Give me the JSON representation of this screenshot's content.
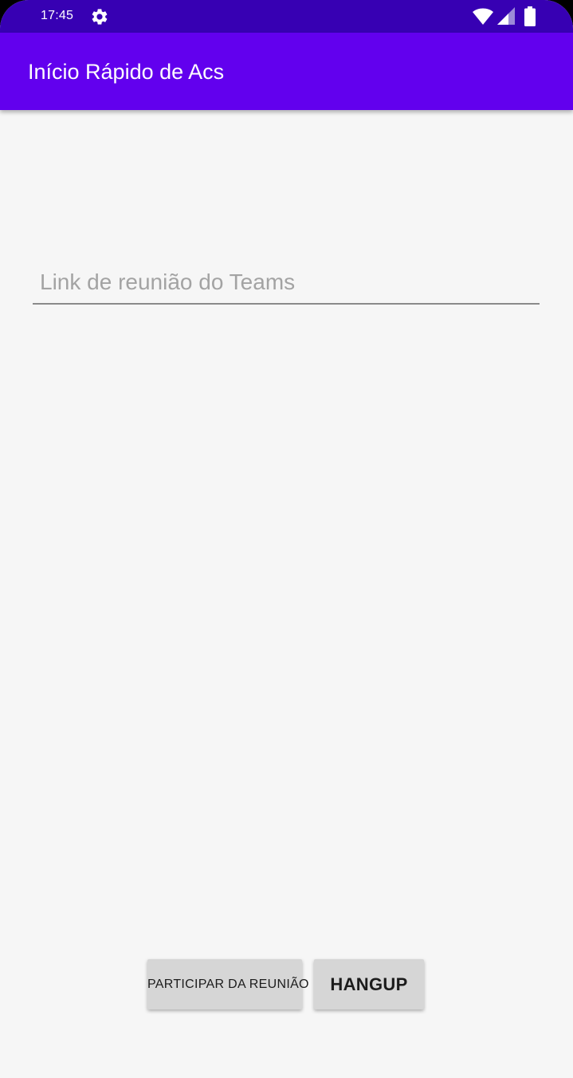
{
  "status_bar": {
    "time": "17:45",
    "icons": [
      "gear-icon",
      "wifi-icon",
      "signal-icon",
      "battery-icon"
    ]
  },
  "app_bar": {
    "title": "Início Rápido de Acs"
  },
  "meeting_link": {
    "value": "",
    "placeholder": "Link de reunião do Teams"
  },
  "actions": {
    "join_label": "PARTICIPAR DA REUNIÃO",
    "hangup_label": "HANGUP"
  },
  "colors": {
    "status_bar": "#3700b3",
    "app_bar": "#6200ee",
    "background": "#f6f6f6",
    "button": "#d6d6d6"
  }
}
